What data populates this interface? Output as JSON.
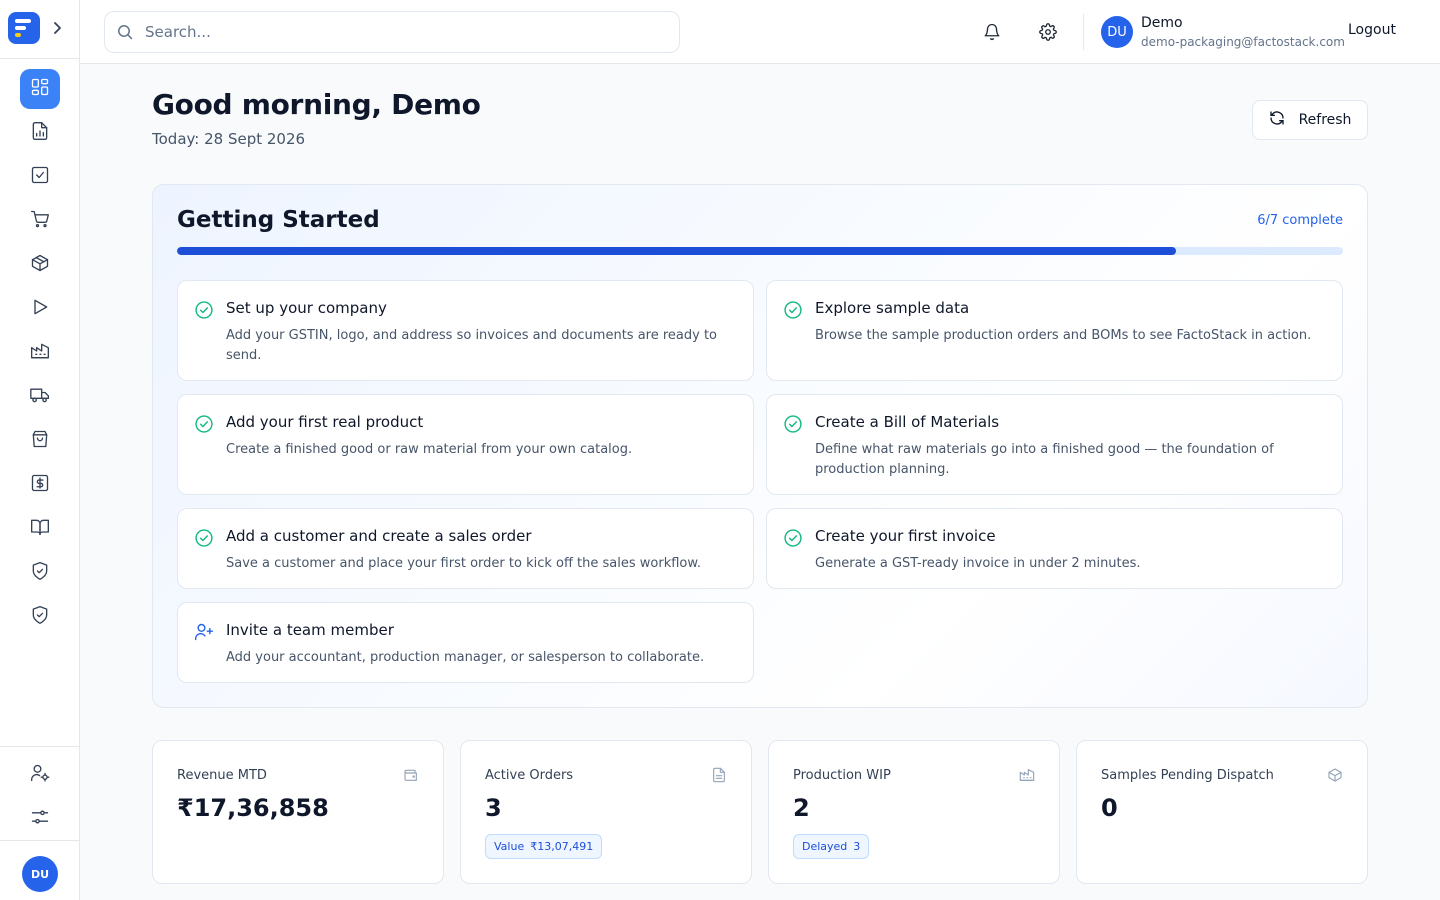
{
  "sidebar": {
    "logo_icon": "factostack-logo",
    "expand_icon": "chevron-right-icon",
    "nav": [
      {
        "icon": "dashboard-icon",
        "active": true
      },
      {
        "icon": "report-icon",
        "active": false
      },
      {
        "icon": "tasks-icon",
        "active": false
      },
      {
        "icon": "cart-icon",
        "active": false
      },
      {
        "icon": "package-icon",
        "active": false
      },
      {
        "icon": "play-icon",
        "active": false
      },
      {
        "icon": "factory-icon",
        "active": false
      },
      {
        "icon": "truck-icon",
        "active": false
      },
      {
        "icon": "shopping-bag-icon",
        "active": false
      },
      {
        "icon": "dollar-icon",
        "active": false
      },
      {
        "icon": "book-icon",
        "active": false
      },
      {
        "icon": "shield-check-icon",
        "active": false
      },
      {
        "icon": "shield-check-icon",
        "active": false
      }
    ],
    "bottom": [
      {
        "icon": "user-settings-icon"
      },
      {
        "icon": "sliders-icon"
      }
    ],
    "avatar_initials": "DU"
  },
  "topbar": {
    "search_placeholder": "Search...",
    "user_initials": "DU",
    "user_name": "Demo",
    "user_email": "demo-packaging@factostack.com",
    "logout_label": "Logout"
  },
  "header": {
    "greeting": "Good morning, Demo",
    "today": "Today: 28 Sept 2026",
    "refresh_label": "Refresh"
  },
  "getting_started": {
    "title": "Getting Started",
    "progress_label": "6/7 complete",
    "progress": 0.857,
    "tasks": [
      {
        "title": "Set up your company",
        "desc": "Add your GSTIN, logo, and address so invoices and documents are ready to send.",
        "done": true
      },
      {
        "title": "Explore sample data",
        "desc": "Browse the sample production orders and BOMs to see FactoStack in action.",
        "done": true
      },
      {
        "title": "Add your first real product",
        "desc": "Create a finished good or raw material from your own catalog.",
        "done": true
      },
      {
        "title": "Create a Bill of Materials",
        "desc": "Define what raw materials go into a finished good — the foundation of production planning.",
        "done": true
      },
      {
        "title": "Add a customer and create a sales order",
        "desc": "Save a customer and place your first order to kick off the sales workflow.",
        "done": true
      },
      {
        "title": "Create your first invoice",
        "desc": "Generate a GST-ready invoice in under 2 minutes.",
        "done": true
      },
      {
        "title": "Invite a team member",
        "desc": "Add your accountant, production manager, or salesperson to collaborate.",
        "done": false
      }
    ]
  },
  "stats": [
    {
      "label": "Revenue MTD",
      "value": "₹17,36,858",
      "icon": "wallet-icon"
    },
    {
      "label": "Active Orders",
      "value": "3",
      "icon": "document-icon",
      "badge_label": "Value",
      "badge_value": "₹13,07,491"
    },
    {
      "label": "Production WIP",
      "value": "2",
      "icon": "factory-icon",
      "badge_label": "Delayed",
      "badge_value": "3"
    },
    {
      "label": "Samples Pending Dispatch",
      "value": "0",
      "icon": "package-send-icon"
    }
  ],
  "colors": {
    "accent": "#2563eb",
    "success": "#10b981",
    "progress_track": "#dbeafe"
  }
}
